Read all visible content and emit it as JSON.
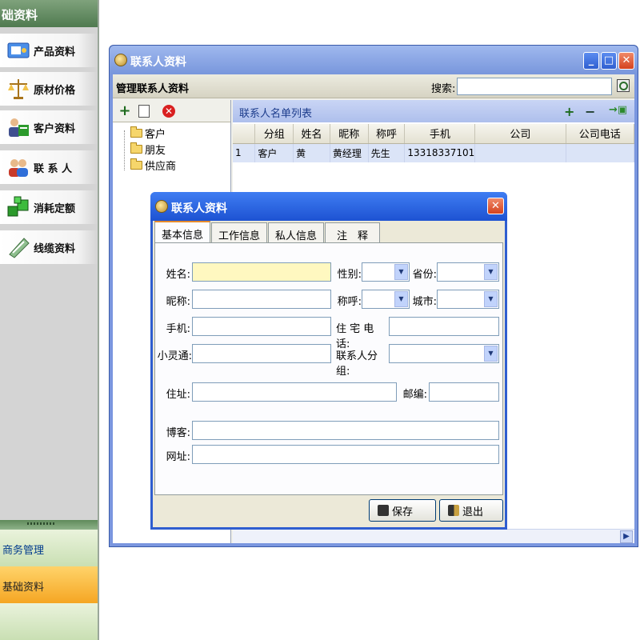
{
  "sidebar": {
    "title": "础资料",
    "items": [
      {
        "label": "产品资料",
        "icon": "product-icon",
        "color": "#2f6ed8"
      },
      {
        "label": "原材价格",
        "icon": "scales-icon",
        "color": "#d9a21c"
      },
      {
        "label": "客户资料",
        "icon": "customers-icon",
        "color": "#4a4a8c"
      },
      {
        "label": "联 系 人",
        "icon": "contacts-icon",
        "color": "#c83a2a"
      },
      {
        "label": "消耗定额",
        "icon": "cubes-icon",
        "color": "#2c9a2c"
      },
      {
        "label": "线缆资料",
        "icon": "cable-icon",
        "color": "#6fa56f"
      }
    ],
    "groups": [
      "商务管理",
      "基础资料"
    ]
  },
  "mainwin": {
    "title": "联系人资料",
    "toolbar_label": "管理联系人资料",
    "search_label": "搜索:",
    "search_value": ""
  },
  "tree": {
    "nodes": [
      "客户",
      "朋友",
      "供应商"
    ]
  },
  "list": {
    "title": "联系人名单列表",
    "columns": [
      "分组",
      "姓名",
      "昵称",
      "称呼",
      "手机",
      "公司",
      "公司电话"
    ],
    "rows": [
      {
        "index": "1",
        "cells": [
          "客户",
          "黄",
          "黄经理",
          "先生",
          "13318337101",
          "",
          ""
        ]
      }
    ]
  },
  "dialog": {
    "title": "联系人资料",
    "tabs": [
      "基本信息",
      "工作信息",
      "私人信息",
      "注　释"
    ],
    "active_tab": "基本信息",
    "fields": {
      "name": {
        "label": "姓名:",
        "value": ""
      },
      "gender": {
        "label": "性别:",
        "value": ""
      },
      "province": {
        "label": "省份:",
        "value": ""
      },
      "nickname": {
        "label": "昵称:",
        "value": ""
      },
      "title": {
        "label": "称呼:",
        "value": ""
      },
      "city": {
        "label": "城市:",
        "value": ""
      },
      "mobile": {
        "label": "手机:",
        "value": ""
      },
      "home_phone": {
        "label": "住 宅 电 话:",
        "value": ""
      },
      "phs": {
        "label": "小灵通:",
        "value": ""
      },
      "contact_group": {
        "label": "联系人分组:",
        "value": ""
      },
      "address": {
        "label": "住址:",
        "value": ""
      },
      "postcode": {
        "label": "邮编:",
        "value": ""
      },
      "blog": {
        "label": "博客:",
        "value": ""
      },
      "website": {
        "label": "网址:",
        "value": ""
      }
    },
    "save_label": "保存",
    "exit_label": "退出"
  },
  "colors": {
    "dialog_title": "#1d52d2",
    "active_input": "#fff8c0",
    "grid_row": "#dbe4f7",
    "active_group": "#f5a623"
  }
}
